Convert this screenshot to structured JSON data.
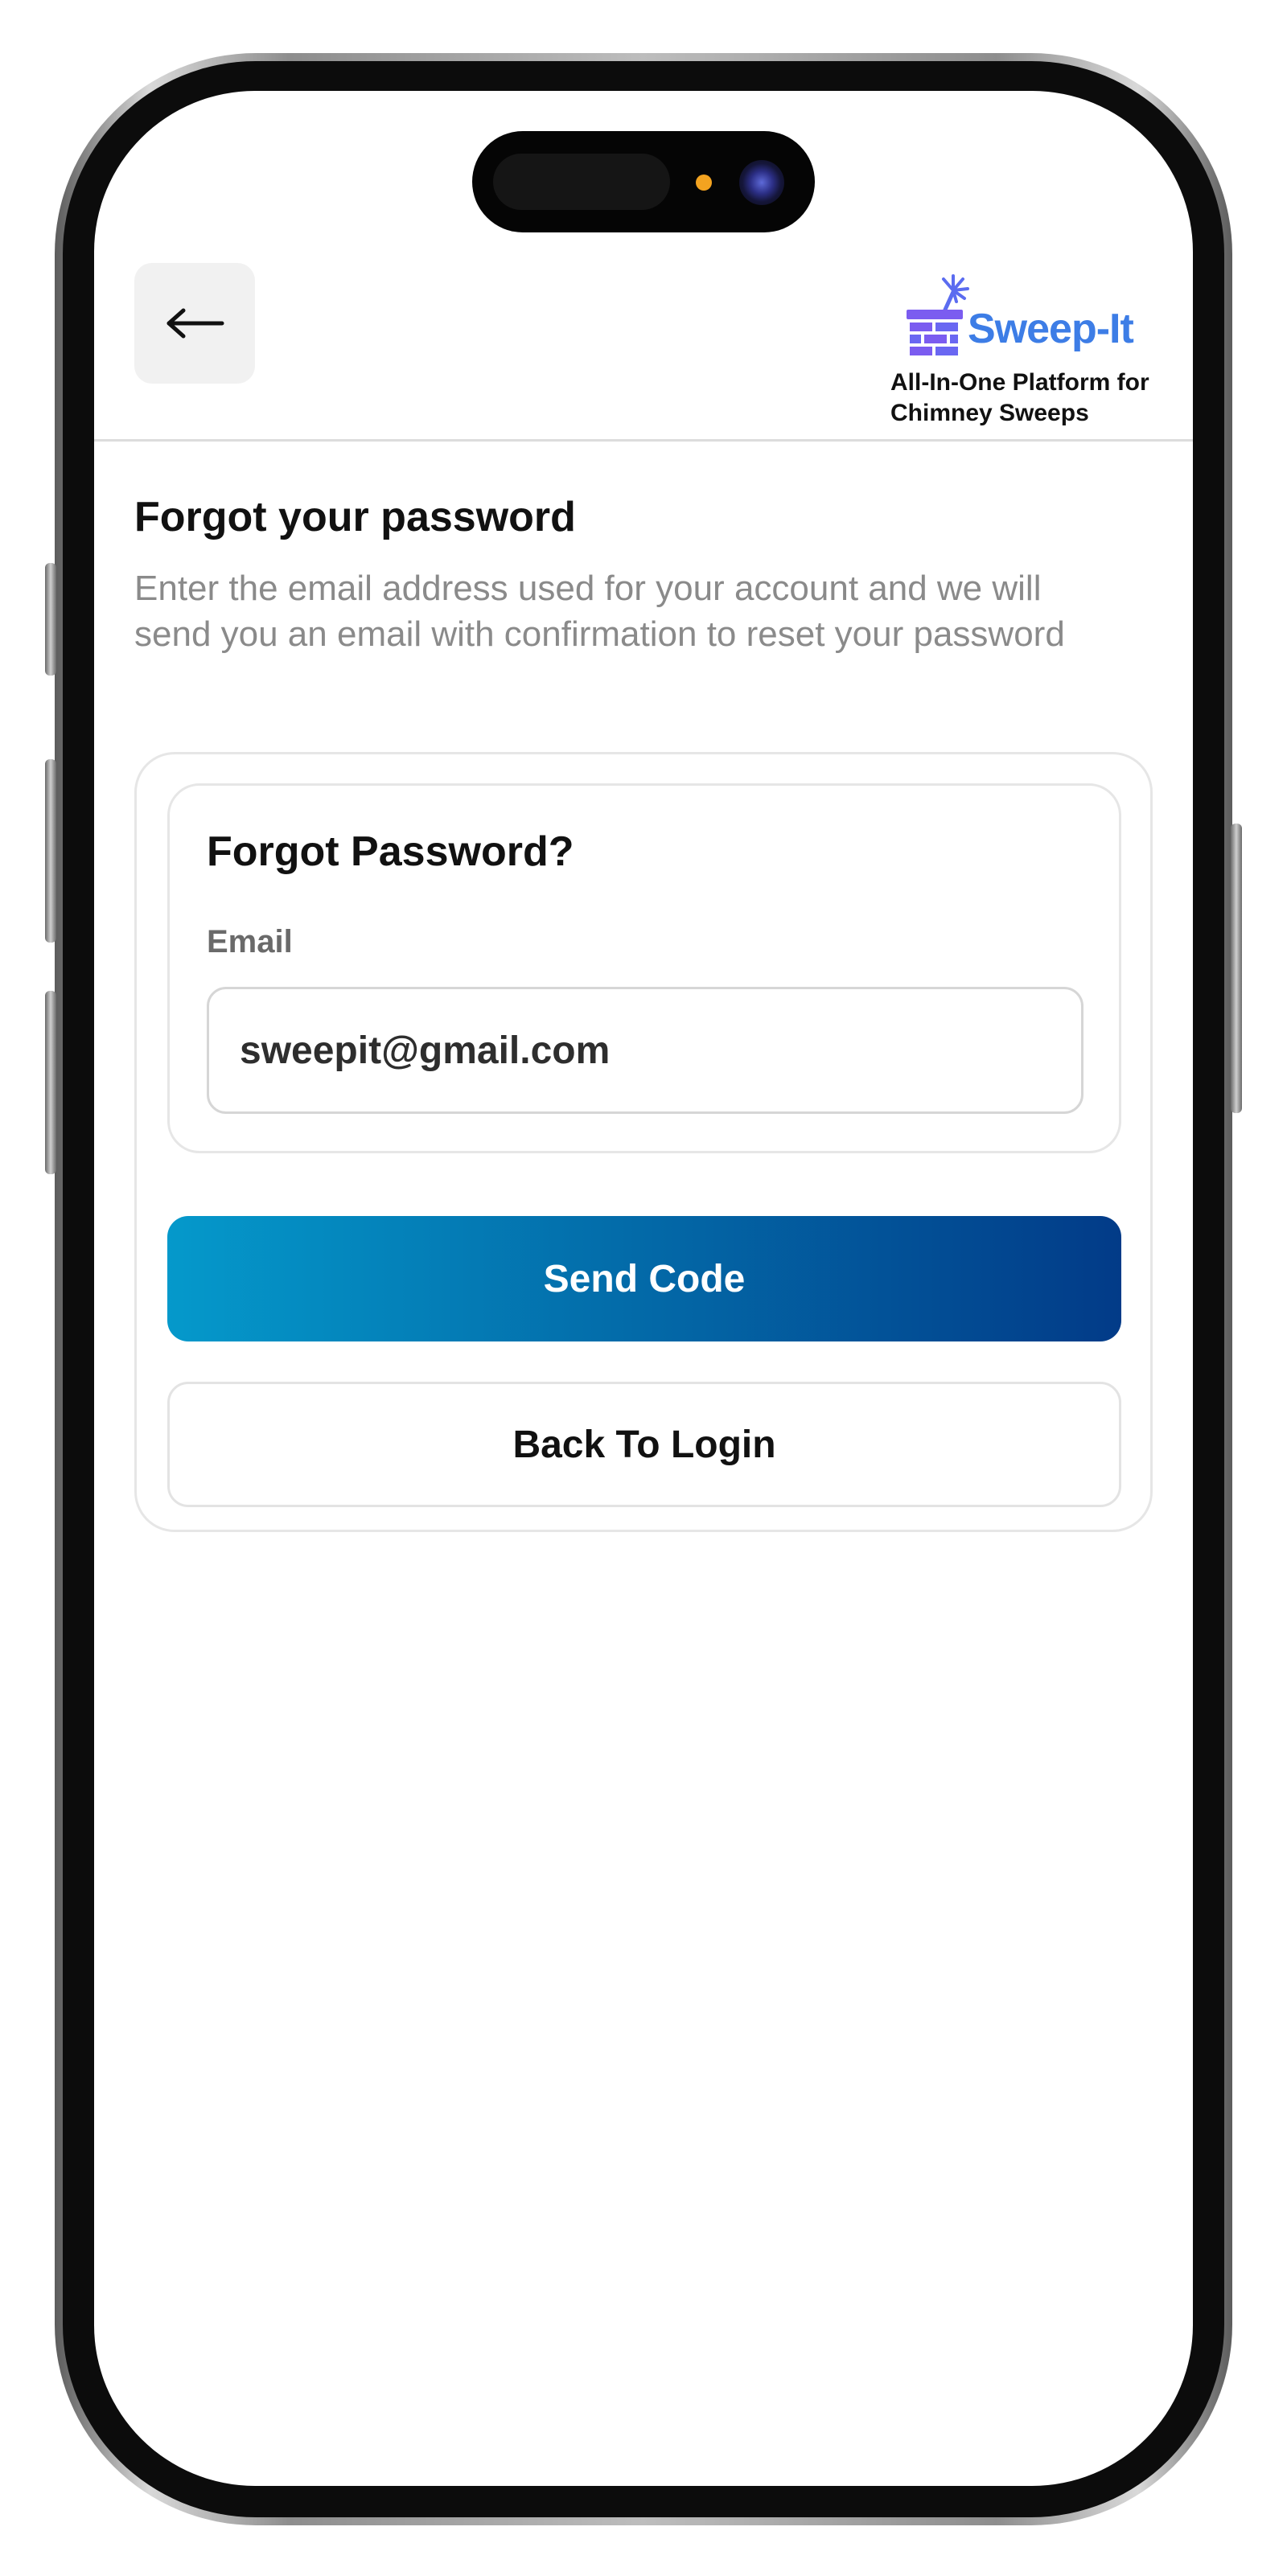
{
  "header": {
    "back_icon": "arrow-left-icon",
    "logo": {
      "name": "Sweep-It",
      "tagline": "All-In-One Platform for Chimney Sweeps",
      "icon": "chimney-brush-icon"
    }
  },
  "main": {
    "title": "Forgot your password",
    "description": "Enter the email address used for your account and we will send you an email with confirmation to reset your password",
    "form": {
      "title": "Forgot Password?",
      "email_label": "Email",
      "email_value": "sweepit@gmail.com"
    },
    "send_code_label": "Send Code",
    "back_to_login_label": "Back To Login"
  },
  "colors": {
    "brand_blue": "#3d7de6",
    "logo_purple": "#7b5cf0",
    "button_gradient_start": "#0599cb",
    "button_gradient_end": "#023b88"
  }
}
